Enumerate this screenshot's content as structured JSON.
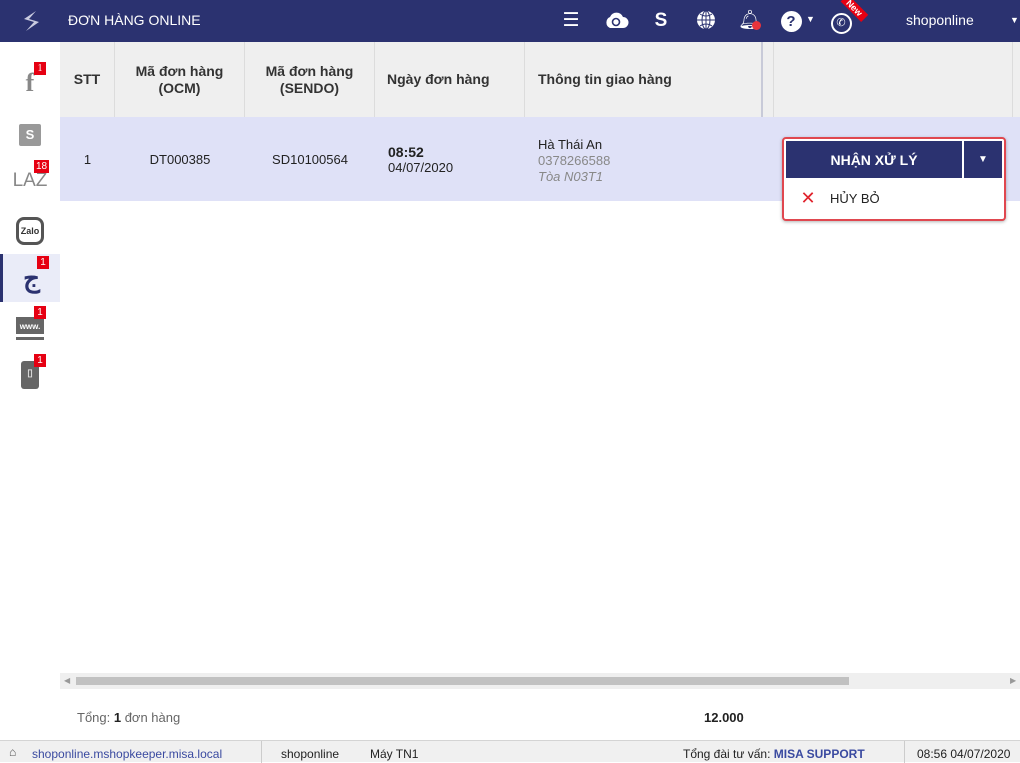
{
  "header": {
    "title": "ĐƠN HÀNG ONLINE",
    "new_ribbon": "New",
    "user": "shoponline"
  },
  "sidebar": {
    "items": [
      {
        "name": "facebook",
        "label": "f",
        "badge": "1"
      },
      {
        "name": "shopee",
        "label": "S",
        "badge": ""
      },
      {
        "name": "lazada",
        "label": "LAZ",
        "badge": "18"
      },
      {
        "name": "zalo",
        "label": "Zalo",
        "badge": ""
      },
      {
        "name": "sendo",
        "label": "ج",
        "badge": "1"
      },
      {
        "name": "website",
        "label": "www.",
        "badge": "1"
      },
      {
        "name": "mobile",
        "label": "▯",
        "badge": "1"
      }
    ]
  },
  "table": {
    "columns": [
      "STT",
      "Mã đơn hàng\n(OCM)",
      "Mã đơn hàng\n(SENDO)",
      "Ngày đơn hàng",
      "Thông tin giao hàng"
    ],
    "rows": [
      {
        "stt": "1",
        "ocm": "DT000385",
        "sendo": "SD10100564",
        "time": "08:52",
        "date": "04/07/2020",
        "name": "Hà Thái An",
        "phone": "0378266588",
        "address": "Tòa N03T1"
      }
    ]
  },
  "actions": {
    "accept": "NHẬN XỬ LÝ",
    "cancel": "HỦY BỎ"
  },
  "footer": {
    "total_prefix": "Tổng: ",
    "total_count": "1",
    "total_suffix": " đơn hàng",
    "amount": "12.000"
  },
  "status": {
    "url": "shoponline.mshopkeeper.misa.local",
    "shop": "shoponline",
    "machine": "Máy TN1",
    "hotline_label": "Tổng đài tư vấn: ",
    "hotline": "MISA SUPPORT",
    "datetime": "08:56 04/07/2020"
  },
  "colors": {
    "primary": "#2b3270",
    "badge": "#e60012",
    "row_selected": "#dfe1f7",
    "danger": "#e0474f"
  }
}
